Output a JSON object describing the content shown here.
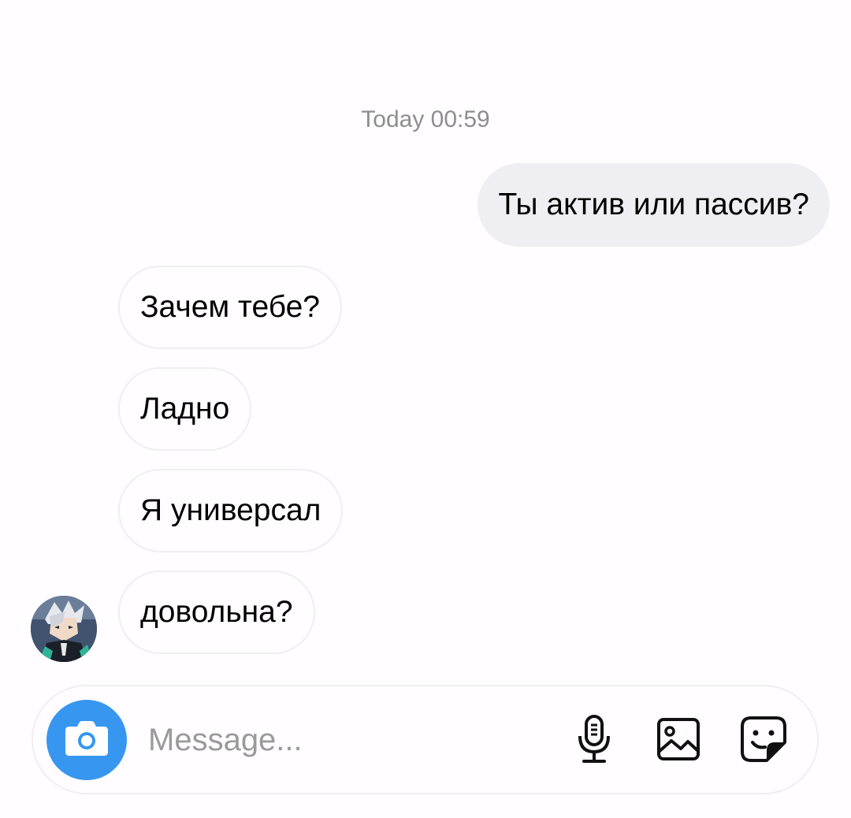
{
  "thread": {
    "timestamp": "Today 00:59"
  },
  "messages": [
    {
      "direction": "outgoing",
      "text": "Ты актив или пассив?"
    },
    {
      "direction": "incoming",
      "text": "Зачем тебе?"
    },
    {
      "direction": "incoming",
      "text": "Ладно"
    },
    {
      "direction": "incoming",
      "text": "Я универсал"
    },
    {
      "direction": "incoming",
      "text": "довольна?"
    }
  ],
  "composer": {
    "placeholder": "Message...",
    "value": "",
    "icons": [
      "camera-icon",
      "microphone-icon",
      "gallery-icon",
      "sticker-icon"
    ],
    "accent_color": "#3797f0"
  }
}
